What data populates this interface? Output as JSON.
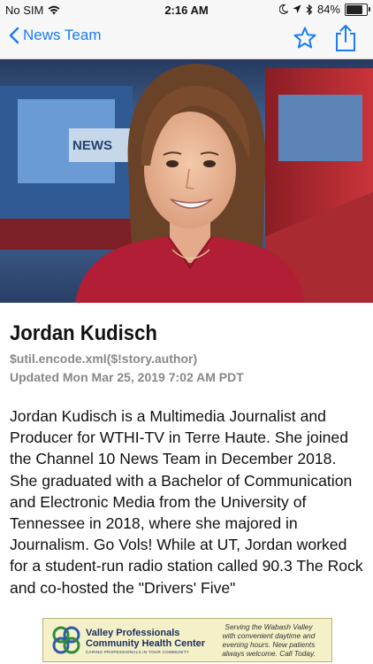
{
  "status_bar": {
    "carrier": "No SIM",
    "time": "2:16 AM",
    "battery": "84%",
    "battery_level": 0.84
  },
  "nav": {
    "back_label": "News Team"
  },
  "article": {
    "name": "Jordan Kudisch",
    "author": "$util.encode.xml($!story.author)",
    "updated": "Updated Mon Mar 25, 2019 7:02 AM PDT",
    "body": "Jordan Kudisch is a Multimedia Journalist and Producer for WTHI-TV in Terre Haute. She joined the Channel 10 News Team in December 2018. She graduated with a Bachelor of Communication and Electronic Media from the University of Tennessee in 2018, where she majored in Journalism. Go Vols! While at UT, Jordan worked for a student-run radio station called 90.3 The Rock and co-hosted the \"Drivers' Five\""
  },
  "hero": {
    "logo_text": "NEWS"
  },
  "ad": {
    "title_line1": "Valley Professionals",
    "title_line2": "Community Health Center",
    "tagline": "CARING PROFESSIONALS IN YOUR COMMUNITY",
    "right_line1": "Serving the Wabash Valley",
    "right_line2": "with convenient daytime and",
    "right_line3": "evening hours. New patients",
    "right_line4": "always welcome. Call Today."
  },
  "colors": {
    "accent": "#1a7cf5",
    "muted": "#888888"
  }
}
